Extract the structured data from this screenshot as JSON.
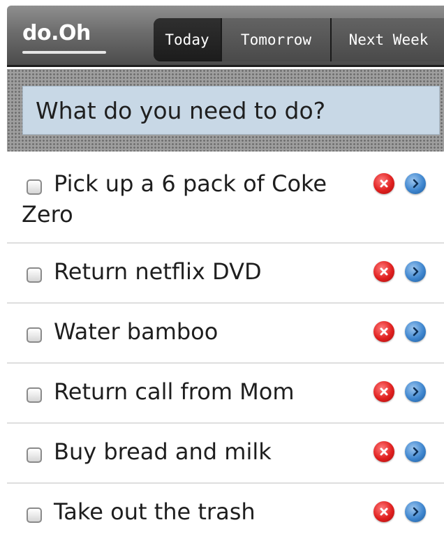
{
  "app": {
    "logo": "do.Oh"
  },
  "tabs": [
    {
      "label": "Today",
      "active": true
    },
    {
      "label": "Tomorrow",
      "active": false
    },
    {
      "label": "Next Week",
      "active": false
    }
  ],
  "new_task": {
    "placeholder": "What do you need to do?"
  },
  "tasks": [
    {
      "text": "Pick up a 6 pack of Coke Zero",
      "done": false
    },
    {
      "text": "Return netflix DVD",
      "done": false
    },
    {
      "text": "Water bamboo",
      "done": false
    },
    {
      "text": "Return call from Mom",
      "done": false
    },
    {
      "text": "Buy bread and milk",
      "done": false
    },
    {
      "text": "Take out the trash",
      "done": false
    }
  ],
  "icons": {
    "delete": "delete-icon",
    "move": "move-forward-icon"
  },
  "colors": {
    "delete": "#e0201f",
    "move": "#3f86cf",
    "input_background": "#c8d8e6"
  }
}
